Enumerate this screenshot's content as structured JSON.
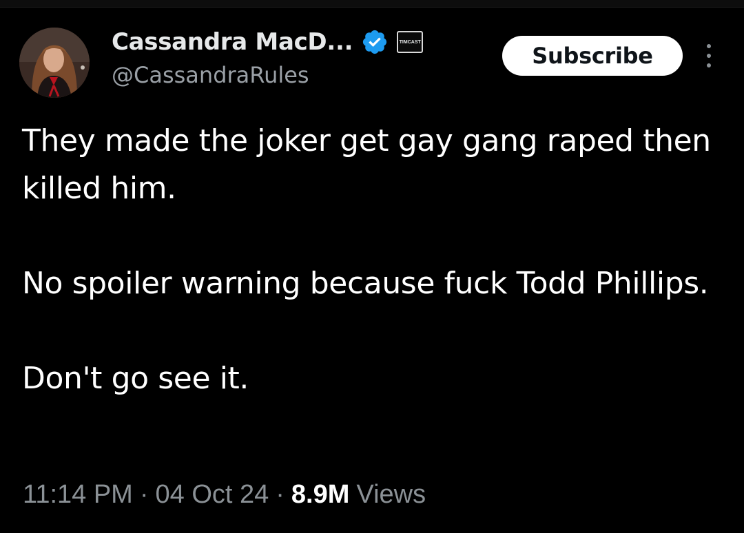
{
  "author": {
    "display_name": "Cassandra MacD...",
    "handle": "@CassandraRules",
    "verified_icon": "verified-badge-icon",
    "affiliate_badge_text": "TIMCAST",
    "avatar_icon": "profile-photo"
  },
  "actions": {
    "subscribe_label": "Subscribe",
    "more_icon": "more-vertical-icon"
  },
  "tweet": {
    "paragraphs": [
      "They made the joker get gay gang raped then killed him.",
      "No spoiler warning because fuck Todd Phillips.",
      "Don't go see it."
    ]
  },
  "meta": {
    "time": "11:14 PM",
    "separator": "·",
    "date": "04 Oct 24",
    "views_count": "8.9M",
    "views_label": "Views"
  },
  "colors": {
    "background": "#000000",
    "text_primary": "#ffffff",
    "text_secondary": "#8b9196",
    "verified_blue": "#1d9bf0",
    "button_bg": "#ffffff"
  }
}
